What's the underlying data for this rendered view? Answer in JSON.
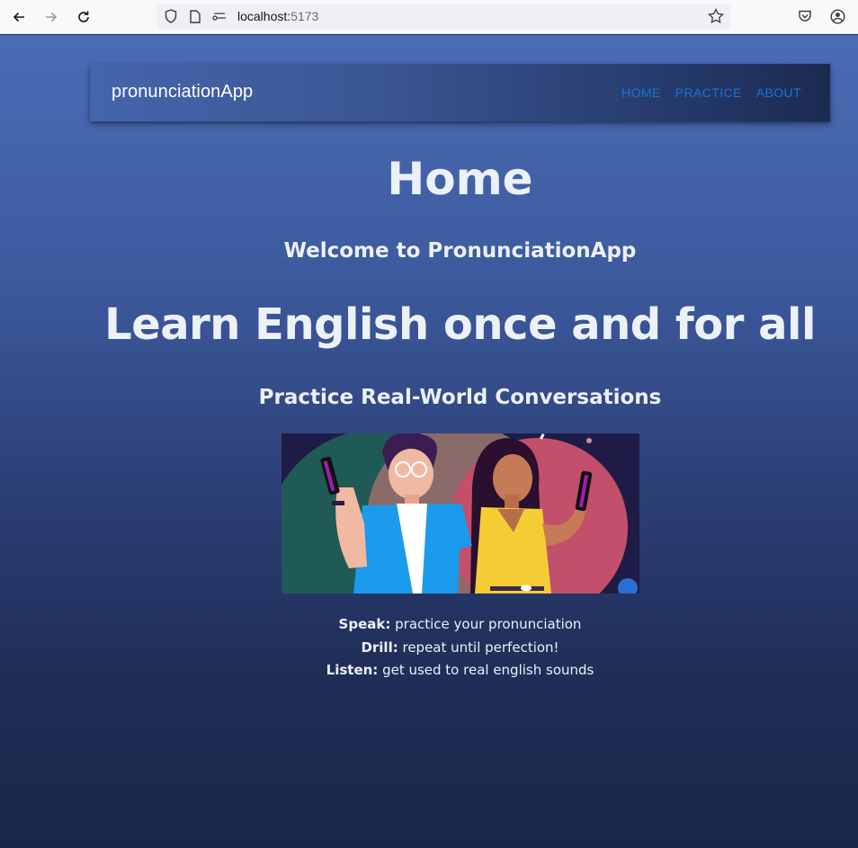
{
  "browser": {
    "url_host": "localhost:",
    "url_port": "5173",
    "icons": [
      "back-icon",
      "forward-icon",
      "reload-icon",
      "shield-icon",
      "page-icon",
      "connection-icon",
      "star-icon",
      "pocket-icon",
      "account-icon"
    ]
  },
  "appbar": {
    "brand": "pronunciationApp",
    "links": [
      {
        "label": "HOME"
      },
      {
        "label": "PRACTICE"
      },
      {
        "label": "ABOUT"
      }
    ],
    "link_color": "#1a73d8"
  },
  "main": {
    "title": "Home",
    "welcome": "Welcome to PronunciationApp",
    "headline": "Learn English once and for all",
    "subheadline": "Practice Real-World Conversations",
    "features": [
      {
        "label": "Speak:",
        "text": " practice your pronunciation"
      },
      {
        "label": "Drill:",
        "text": " repeat until perfection!"
      },
      {
        "label": "Listen:",
        "text": " get used to real english sounds"
      }
    ]
  },
  "colors": {
    "gradient_top": "#4a6cb6",
    "gradient_bottom": "#1b2749",
    "text": "#ecf0f7"
  }
}
